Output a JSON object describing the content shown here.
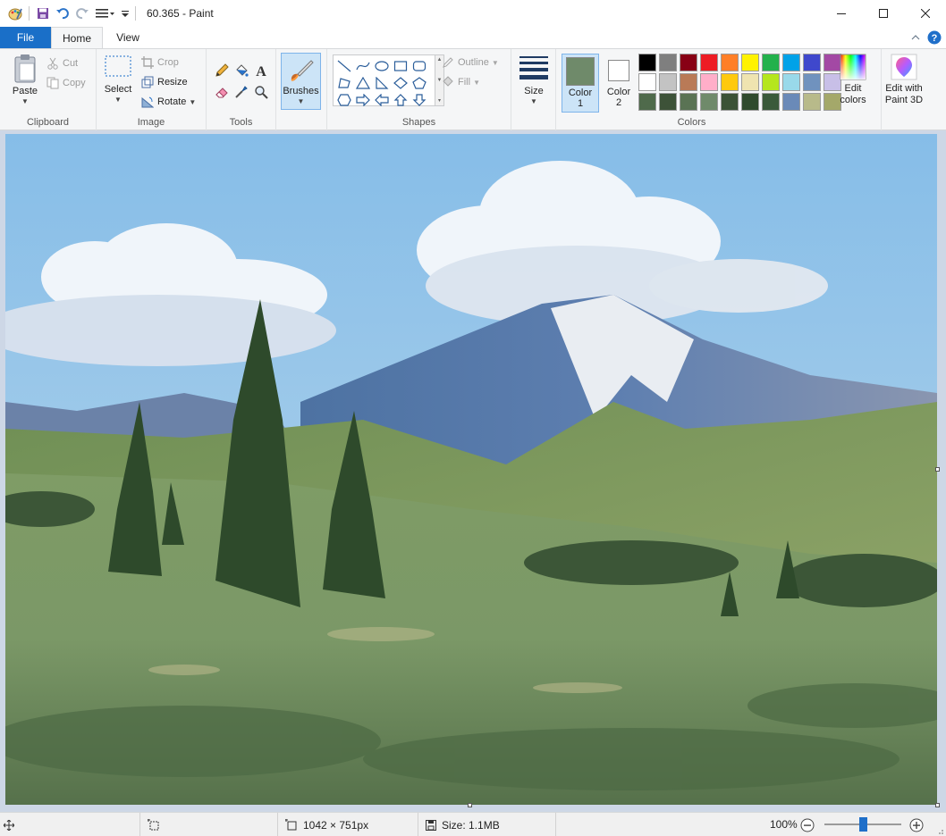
{
  "window": {
    "title": "60.365 - Paint"
  },
  "tabs": {
    "file": "File",
    "home": "Home",
    "view": "View"
  },
  "ribbon": {
    "clipboard": {
      "label": "Clipboard",
      "paste": "Paste",
      "cut": "Cut",
      "copy": "Copy"
    },
    "image": {
      "label": "Image",
      "select": "Select",
      "crop": "Crop",
      "resize": "Resize",
      "rotate": "Rotate"
    },
    "tools": {
      "label": "Tools"
    },
    "brushes": {
      "label": "Brushes"
    },
    "shapes": {
      "label": "Shapes",
      "outline": "Outline",
      "fill": "Fill"
    },
    "size": {
      "label": "Size"
    },
    "colors": {
      "label": "Colors",
      "color1_label": "Color",
      "color1_num": "1",
      "color2_label": "Color",
      "color2_num": "2",
      "color1_value": "#6f8a6a",
      "color2_value": "#ffffff",
      "edit_colors_line1": "Edit",
      "edit_colors_line2": "colors",
      "edit_3d_line1": "Edit with",
      "edit_3d_line2": "Paint 3D",
      "palette": [
        "#000000",
        "#7f7f7f",
        "#880015",
        "#ed1c24",
        "#ff7f27",
        "#fff200",
        "#22b14c",
        "#00a2e8",
        "#3f48cc",
        "#a349a4",
        "#ffffff",
        "#c3c3c3",
        "#b97a57",
        "#ffaec9",
        "#ffc90e",
        "#efe4b0",
        "#b5e61d",
        "#99d9ea",
        "#7092be",
        "#c8bfe7",
        "#4f6a4b",
        "#3d5238",
        "#5a7354",
        "#6f8a6a",
        "#3b5236",
        "#2f4a2d",
        "#3a5a3a",
        "#6a8ab8",
        "#b8ba8a",
        "#a4a86a"
      ]
    }
  },
  "statusbar": {
    "dimensions": "1042 × 751px",
    "size": "Size: 1.1MB",
    "zoom": "100%",
    "zoom_fraction": 0.5
  },
  "icons": {
    "app": "paint-palette-icon",
    "save": "save-icon",
    "undo": "undo-icon",
    "redo": "redo-icon",
    "help": "help-icon"
  }
}
